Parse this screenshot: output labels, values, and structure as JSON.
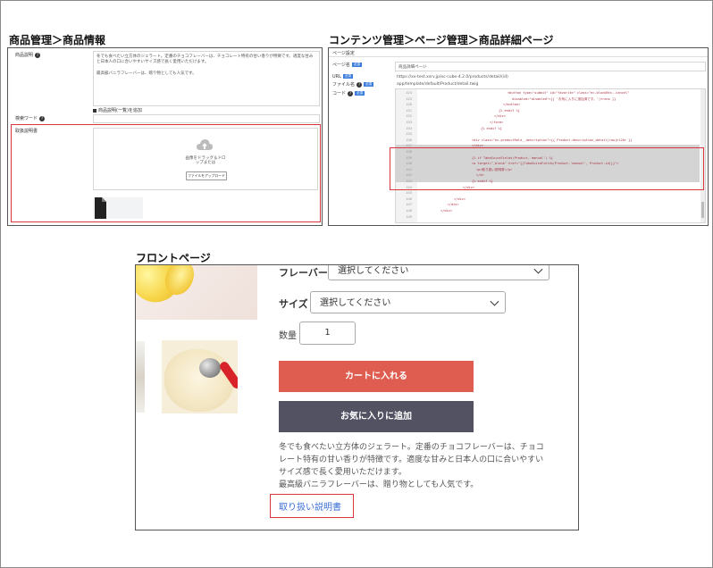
{
  "titles": {
    "product_admin": "商品管理＞商品情報",
    "content_admin": "コンテンツ管理＞ページ管理＞商品詳細ページ",
    "front_page": "フロントページ"
  },
  "product_panel": {
    "desc_label": "商品説明",
    "desc_text_lines": [
      "冬でも食べたい立方体のジェラート。定番のチョコフレーバーは、チョコレート特有の甘い香りが特徴です。適度な甘みと日本人の口に合いやすいサイズ感で長く愛用いただけます。",
      "最高級バニラフレーバーは、贈り物としても人気です。"
    ],
    "list_desc_toggle": "商品説明(一覧)を追加",
    "search_word_label": "検索ワード",
    "manual_label": "取扱説明書",
    "upload_hint": "画像をドラッグ＆ドロップまたは",
    "upload_button": "ファイルをアップロード"
  },
  "content_panel": {
    "page_setting": "ページ設定",
    "page_name_label": "ページ名",
    "page_name_value": "商品詳細ページ",
    "url_label": "URL",
    "url_value": "https://xx-test.xsrv.jp/ec-cube-4.2.0/products/detail/(id)",
    "file_name_label": "ファイル名",
    "file_name_value": "app/template/default/Product/detail.twig",
    "code_label": "コード",
    "badge_text": "必須",
    "code_lines": [
      {
        "n": "424",
        "t": "<button type=\"submit\" id=\"favorite\" class=\"ec-blockBtn--cancel\""
      },
      {
        "n": "425",
        "t": "disabled=\"disabled\">{{ 'お気に入りに追加済です。'|trans }}"
      },
      {
        "n": "426",
        "t": "</button>"
      },
      {
        "n": "431",
        "t": "{% endif %}"
      },
      {
        "n": "432",
        "t": "</div>"
      },
      {
        "n": "433",
        "t": "</form>"
      },
      {
        "n": "434",
        "t": "{% endif %}"
      },
      {
        "n": "435",
        "t": ""
      },
      {
        "n": "436",
        "t": "<div class=\"ec-productRole__description\">{{ Product.description_detail|raw|nl2br }}"
      },
      {
        "n": "437",
        "t": "</div>"
      },
      {
        "n": "438",
        "t": ""
      },
      {
        "n": "439",
        "t": "{% if TabaSuicaFields(Product,'manual') %}"
      },
      {
        "n": "440",
        "t": "<a target=\"_blank\" href=\"{{TabaSuicaFields(Product,'manual', Product.id)}}\">"
      },
      {
        "n": "441",
        "t": "<p>取り扱い説明書</p>"
      },
      {
        "n": "442",
        "t": "</a>"
      },
      {
        "n": "443",
        "t": "{% endif %}"
      },
      {
        "n": "444",
        "t": "</div>"
      },
      {
        "n": "445",
        "t": ""
      },
      {
        "n": "446",
        "t": "</div>"
      },
      {
        "n": "447",
        "t": "</div>"
      },
      {
        "n": "448",
        "t": "</div>"
      },
      {
        "n": "449",
        "t": ""
      }
    ]
  },
  "front": {
    "flavor_label": "フレーバー",
    "size_label": "サイズ",
    "select_placeholder": "選択してください",
    "quantity_label": "数量",
    "quantity_value": "1",
    "add_to_cart": "カートに入れる",
    "add_to_favorite": "お気に入りに追加",
    "description_lines": [
      "冬でも食べたい立方体のジェラート。定番のチョコフレーバーは、チョコ",
      "レート特有の甘い香りが特徴です。適度な甘みと日本人の口に合いやすい",
      "サイズ感で長く愛用いただけます。",
      "最高級バニラフレーバーは、贈り物としても人気です。"
    ],
    "manual_link": "取り扱い説明書"
  },
  "colors": {
    "cart_button": "#de5d50",
    "favorite_button": "#525263",
    "highlight_border": "#d9363e"
  }
}
